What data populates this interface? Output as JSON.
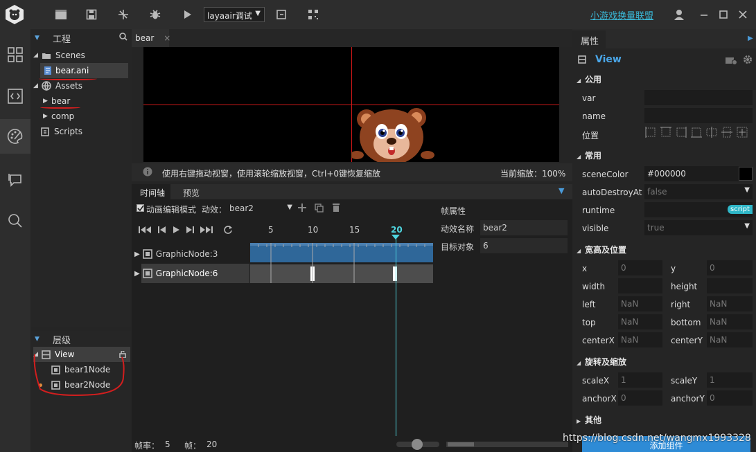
{
  "toolbar": {
    "debug_select": "layaair调试",
    "promo_link": "小游戏换量联盟"
  },
  "project": {
    "title": "工程",
    "items": [
      {
        "label": "Scenes"
      },
      {
        "label": "bear.ani"
      },
      {
        "label": "Assets"
      },
      {
        "label": "bear"
      },
      {
        "label": "comp"
      },
      {
        "label": "Scripts"
      }
    ]
  },
  "hierarchy": {
    "title": "层级",
    "items": [
      {
        "label": "View"
      },
      {
        "label": "bear1Node"
      },
      {
        "label": "bear2Node"
      }
    ]
  },
  "editor": {
    "tab": "bear",
    "tab_close": "×",
    "hint": "使用右键拖动视窗，使用滚轮缩放视窗，Ctrl+0键恢复缩放",
    "zoom_label": "当前缩放：100%"
  },
  "timeline": {
    "tabs": [
      "时间轴",
      "预览"
    ],
    "edit_mode_label": "动画编辑模式",
    "effect_label": "动效：",
    "effect_value": "bear2",
    "ruler": [
      "5",
      "10",
      "15",
      "20"
    ],
    "tracks": [
      {
        "label": "GraphicNode:3"
      },
      {
        "label": "GraphicNode:6"
      }
    ],
    "frame_props": {
      "title": "帧属性",
      "name_label": "动效名称",
      "name_value": "bear2",
      "target_label": "目标对象",
      "target_value": "6"
    }
  },
  "status": {
    "fps_label": "帧率：",
    "fps_value": "5",
    "frame_label": "帧：",
    "frame_value": "20"
  },
  "props": {
    "tab": "属性",
    "view_title": "View",
    "sections": {
      "public": "公用",
      "common": "常用",
      "size": "宽高及位置",
      "rotate": "旋转及缩放",
      "other": "其他"
    },
    "var_label": "var",
    "name_label": "name",
    "pos_label": "位置",
    "sceneColor_label": "sceneColor",
    "sceneColor_value": "#000000",
    "autoDestroy_label": "autoDestroyAt",
    "autoDestroy_value": "false",
    "runtime_label": "runtime",
    "runtime_badge": "script",
    "visible_label": "visible",
    "visible_value": "true",
    "x_label": "x",
    "x_value": "0",
    "y_label": "y",
    "y_value": "0",
    "width_label": "width",
    "height_label": "height",
    "left_label": "left",
    "left_value": "NaN",
    "right_label": "right",
    "right_value": "NaN",
    "top_label": "top",
    "top_value": "NaN",
    "bottom_label": "bottom",
    "bottom_value": "NaN",
    "centerX_label": "centerX",
    "centerX_value": "NaN",
    "centerY_label": "centerY",
    "centerY_value": "NaN",
    "scaleX_label": "scaleX",
    "scaleX_value": "1",
    "scaleY_label": "scaleY",
    "scaleY_value": "1",
    "anchorX_label": "anchorX",
    "anchorX_value": "0",
    "anchorY_label": "anchorY",
    "anchorY_value": "0",
    "add_component": "添加组件"
  },
  "watermark": "https://blog.csdn.net/wangmx1993328"
}
